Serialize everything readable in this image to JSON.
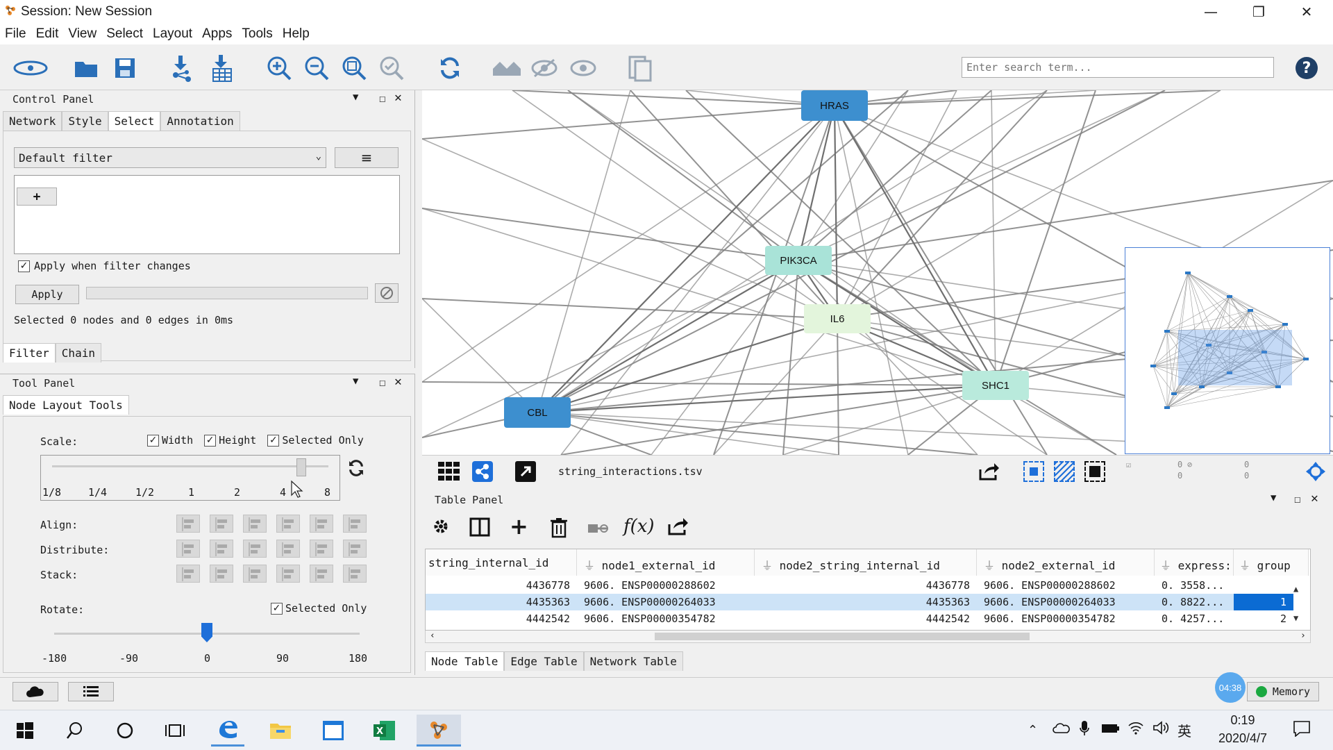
{
  "window": {
    "title": "Session: New Session",
    "controls": [
      "—",
      "❐",
      "✕"
    ]
  },
  "menu": [
    "File",
    "Edit",
    "View",
    "Select",
    "Layout",
    "Apps",
    "Tools",
    "Help"
  ],
  "search": {
    "placeholder": "Enter search term..."
  },
  "control_panel": {
    "title": "Control Panel",
    "tabs": [
      "Network",
      "Style",
      "Select",
      "Annotation"
    ],
    "filter_dropdown": "Default filter",
    "add_button": "+",
    "apply_checkbox_label": "Apply when filter changes",
    "apply_button": "Apply",
    "status": "Selected 0 nodes and 0 edges in 0ms",
    "bottom_tabs": [
      "Filter",
      "Chain"
    ]
  },
  "tool_panel": {
    "title": "Tool Panel",
    "tab": "Node Layout Tools",
    "scale_label": "Scale:",
    "scale_checks": [
      "Width",
      "Height",
      "Selected Only"
    ],
    "scale_ticks": [
      "1/8",
      "1/4",
      "1/2",
      "1",
      "2",
      "4",
      "8"
    ],
    "scale_value": 4,
    "align_label": "Align:",
    "distribute_label": "Distribute:",
    "stack_label": "Stack:",
    "rotate_label": "Rotate:",
    "rotate_selected_only": "Selected Only",
    "rotate_ticks": [
      "-180",
      "-90",
      "0",
      "90",
      "180"
    ],
    "rotate_value": 0
  },
  "network": {
    "nodes": [
      {
        "id": "HRAS",
        "label": "HRAS",
        "color": "#3d8fcf"
      },
      {
        "id": "PIK3CA",
        "label": "PIK3CA",
        "color": "#a9e3d8"
      },
      {
        "id": "IL6",
        "label": "IL6",
        "color": "#e3f5dc"
      },
      {
        "id": "SHC1",
        "label": "SHC1",
        "color": "#b9eadc"
      },
      {
        "id": "CBL",
        "label": "CBL",
        "color": "#3d8fcf"
      }
    ],
    "file_name": "string_interactions.tsv",
    "counts": [
      "0",
      "0",
      "0",
      "0"
    ]
  },
  "table_panel": {
    "title": "Table Panel",
    "columns": [
      "string_internal_id",
      "node1_external_id",
      "node2_string_internal_id",
      "node2_external_id",
      "express:",
      "group"
    ],
    "rows": [
      [
        "4436778",
        "9606. ENSP00000288602",
        "4436778",
        "9606. ENSP00000288602",
        "0. 3558...",
        ""
      ],
      [
        "4435363",
        "9606. ENSP00000264033",
        "4435363",
        "9606. ENSP00000264033",
        "0. 8822...",
        "1"
      ],
      [
        "4442542",
        "9606. ENSP00000354782",
        "4442542",
        "9606. ENSP00000354782",
        "0. 4257...",
        "2"
      ]
    ],
    "bottom_tabs": [
      "Node Table",
      "Edge Table",
      "Network Table"
    ]
  },
  "status_bar": {
    "memory": "Memory",
    "timer": "04:38"
  },
  "taskbar": {
    "time": "0:19",
    "date": "2020/4/7",
    "ime": "英"
  },
  "colors": {
    "accent": "#1e6fd9",
    "selected_row": "#cde3f7",
    "selected_cell": "#0b6bd3",
    "node_blue": "#3d8fcf"
  }
}
